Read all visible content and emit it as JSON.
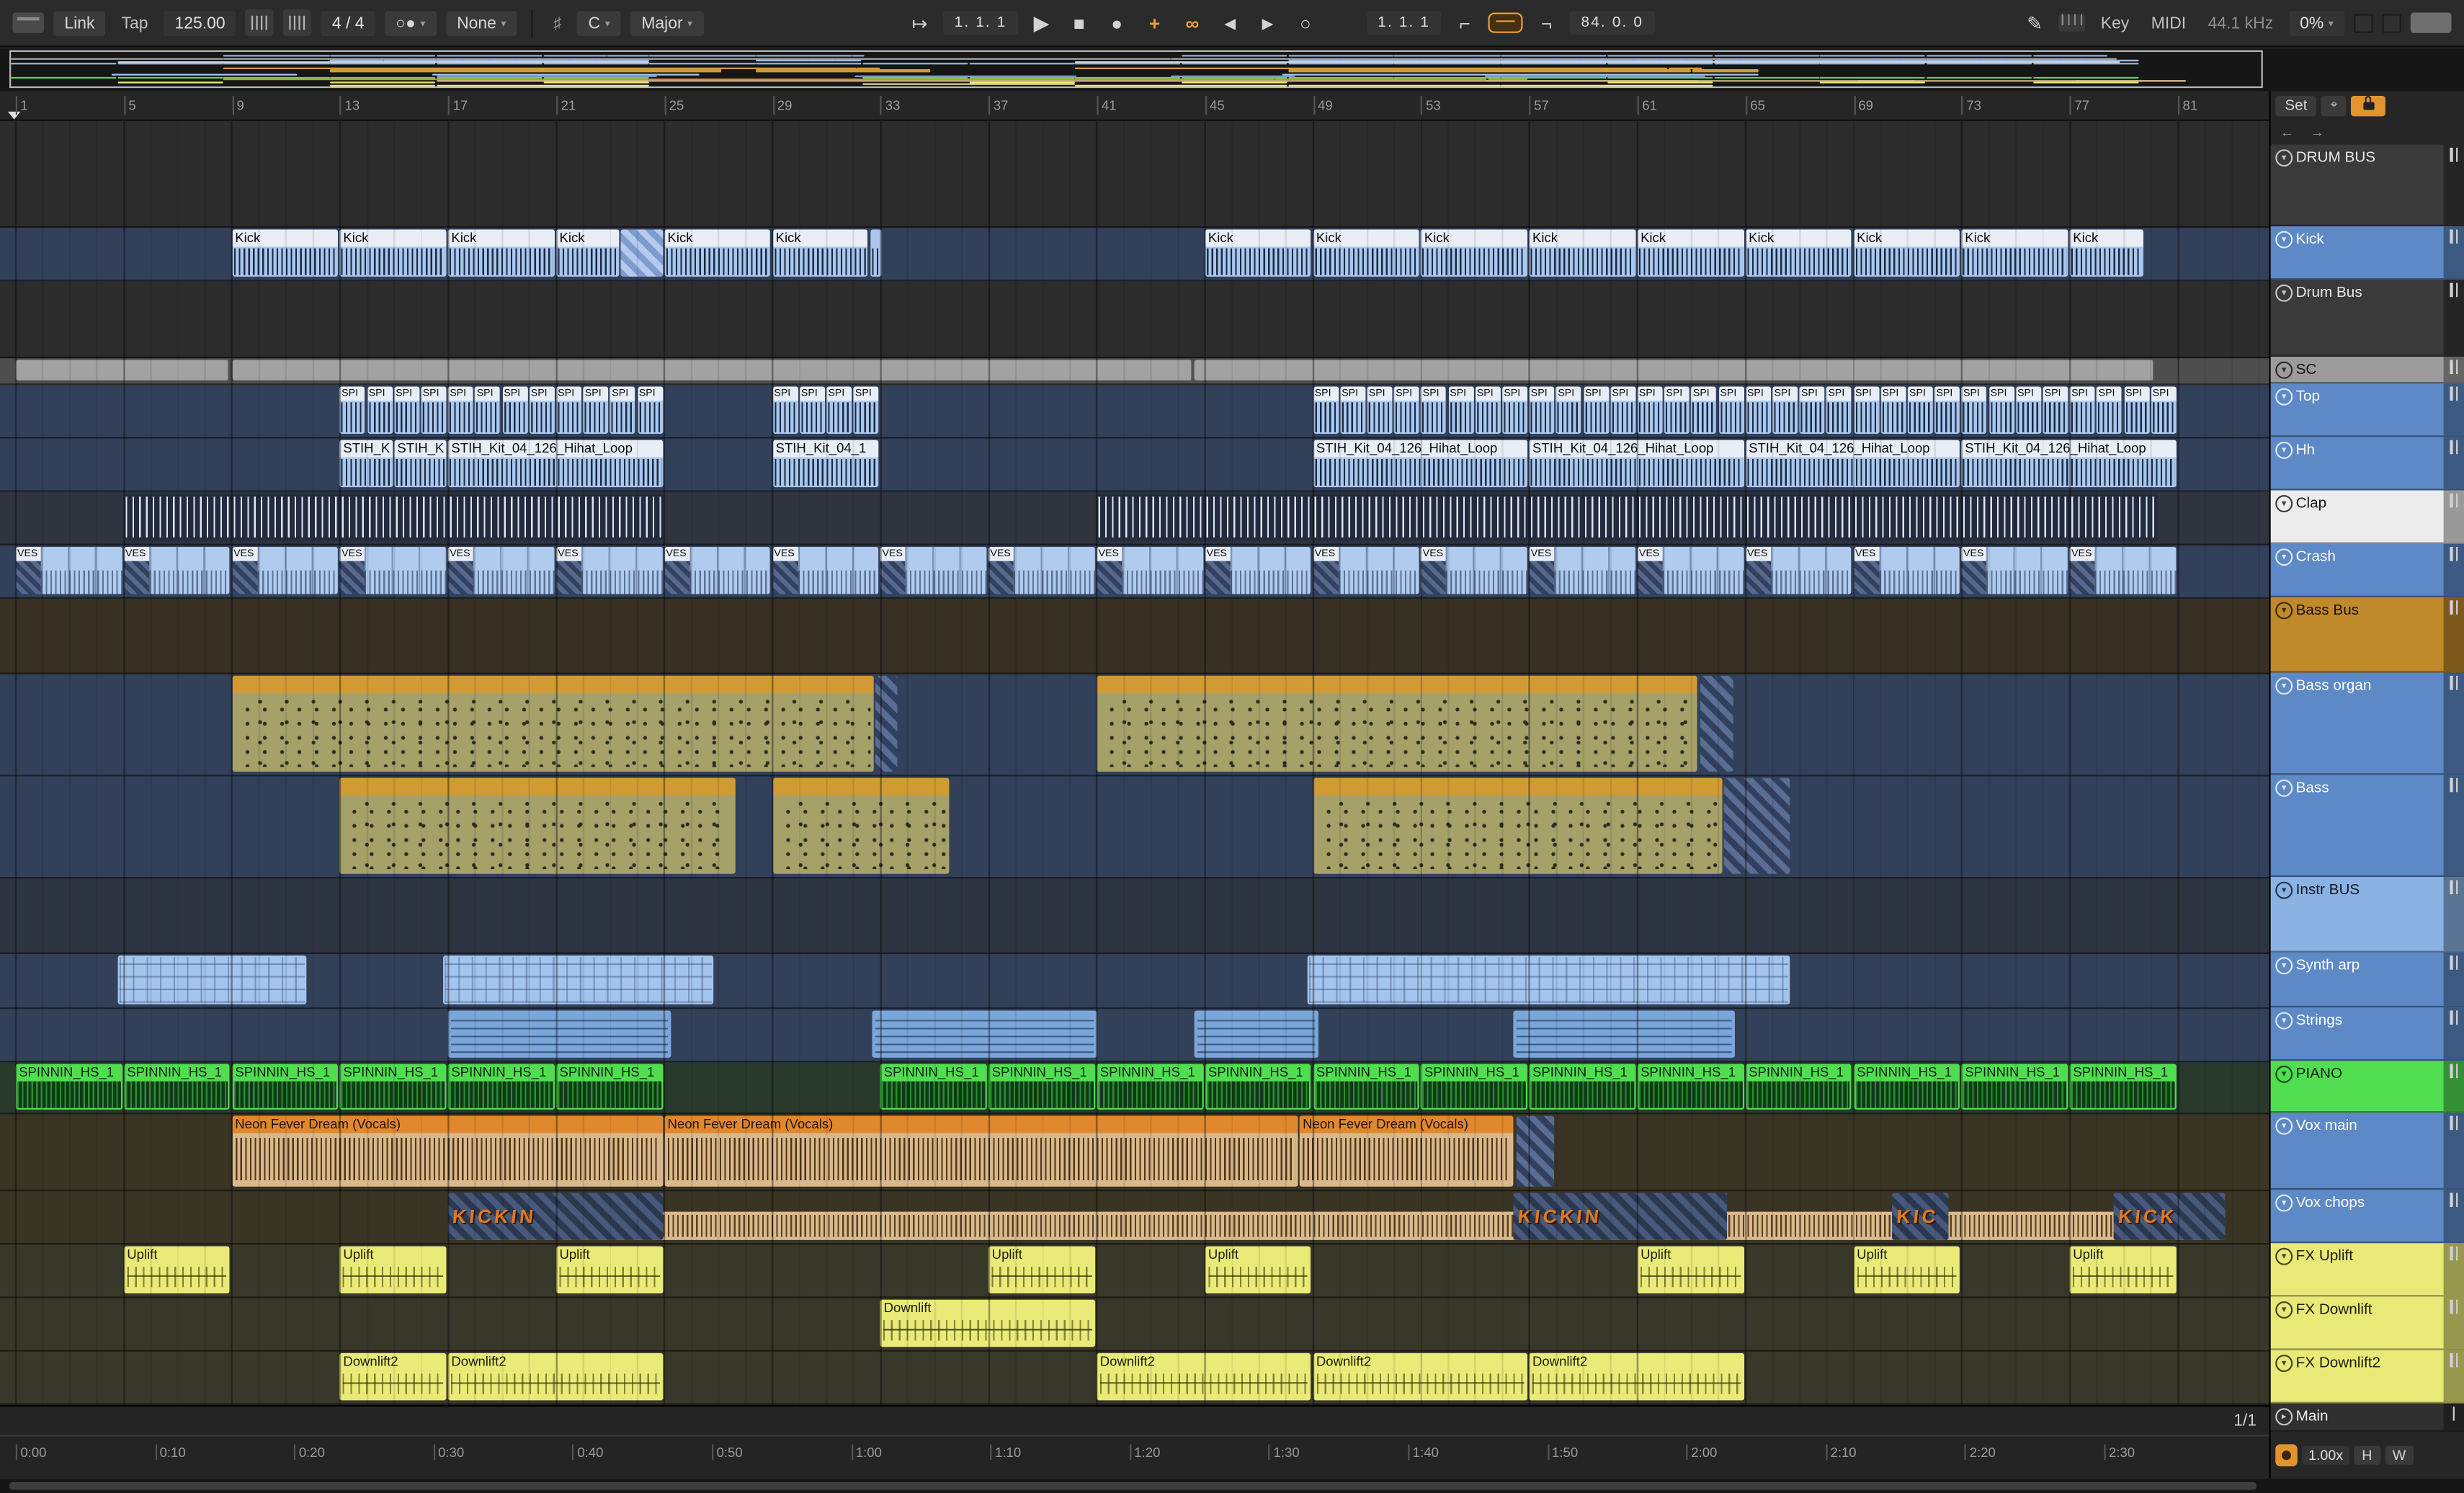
{
  "toolbar": {
    "link": "Link",
    "tap": "Tap",
    "tempo": "125.00",
    "time_sig": "4 / 4",
    "groove": "None",
    "scale_root": "C",
    "scale_name": "Major",
    "position": "1.  1.  1",
    "loop_start": "1.  1.  1",
    "loop_length": "84. 0. 0",
    "key": "Key",
    "midi": "MIDI",
    "sample_rate": "44.1 kHz",
    "cpu": "0%"
  },
  "sidebar": {
    "set": "Set",
    "back": "←",
    "forward": "→",
    "main": "Main",
    "pane": "1/1",
    "zoom": "1.00x",
    "h": "H",
    "w": "W"
  },
  "ruler_bars": [
    1,
    5,
    9,
    13,
    17,
    21,
    25,
    29,
    33,
    37,
    41,
    45,
    49,
    53,
    57,
    61,
    65,
    69,
    73,
    77,
    81
  ],
  "time_labels": [
    "0:00",
    "0:10",
    "0:20",
    "0:30",
    "0:40",
    "0:50",
    "1:00",
    "1:10",
    "1:20",
    "1:30",
    "1:40",
    "1:50",
    "2:00",
    "2:10",
    "2:20",
    "2:30"
  ],
  "accent_colors": {
    "active_orange": "#f0a030",
    "track_blue": "#5d89c6",
    "track_green": "#50de50",
    "track_yellow": "#e9e977",
    "track_orange": "#c08a2a"
  },
  "tracks": [
    {
      "name": "DRUM BUS",
      "group": true,
      "h": 68,
      "sh": 52,
      "cell": "#3a3a3a",
      "text": "#e8e8e8",
      "lane": "#2c2c2c",
      "ov": "#4a4a4a",
      "clips": []
    },
    {
      "name": "Kick",
      "h": 34,
      "cell": "#5d89c6",
      "text": "#ffffff",
      "lane": "#33405a",
      "kind": "kick",
      "ov": "#9db9e2",
      "clips": [
        {
          "s": 9,
          "l": 4,
          "lab": "Kick"
        },
        {
          "s": 13,
          "l": 4,
          "lab": "Kick"
        },
        {
          "s": 17,
          "l": 4,
          "lab": "Kick"
        },
        {
          "s": 21,
          "l": 2.4,
          "lab": "Kick"
        },
        {
          "s": 23.4,
          "l": 1.6,
          "kind": "kickhatch"
        },
        {
          "s": 25,
          "l": 4,
          "lab": "Kick"
        },
        {
          "s": 29,
          "l": 3.6,
          "lab": "Kick"
        },
        {
          "s": 32.6,
          "l": 0.5
        },
        {
          "s": 45,
          "l": 4,
          "lab": "Kick"
        },
        {
          "s": 49,
          "l": 4,
          "lab": "Kick"
        },
        {
          "s": 53,
          "l": 4,
          "lab": "Kick"
        },
        {
          "s": 57,
          "l": 4,
          "lab": "Kick"
        },
        {
          "s": 61,
          "l": 4,
          "lab": "Kick"
        },
        {
          "s": 65,
          "l": 4,
          "lab": "Kick"
        },
        {
          "s": 69,
          "l": 4,
          "lab": "Kick"
        },
        {
          "s": 73,
          "l": 4,
          "lab": "Kick"
        },
        {
          "s": 77,
          "l": 2.8,
          "lab": "Kick"
        }
      ]
    },
    {
      "name": "Drum Bus",
      "group": true,
      "h": 49,
      "cell": "#3a3a3a",
      "text": "#e8e8e8",
      "lane": "#2c2c2c",
      "ov": "#4a4a4a",
      "clips": []
    },
    {
      "name": "SC",
      "h": 17,
      "cell": "#9c9c9c",
      "text": "#111111",
      "lane": "#4e4e4e",
      "kind": "gray",
      "ov": "#a8a8a8",
      "clips": [
        {
          "s": 1,
          "l": 8
        },
        {
          "s": 9,
          "l": 35.6
        },
        {
          "s": 44.6,
          "l": 35.6
        }
      ]
    },
    {
      "name": "Top",
      "h": 34,
      "cell": "#5d89c6",
      "text": "#ffffff",
      "lane": "#33405a",
      "kind": "spi",
      "ov": "#9db9e2",
      "clips": [
        {
          "rep": {
            "from": 13,
            "count": 12,
            "step": 1
          },
          "l": 1,
          "lab": "SPI"
        },
        {
          "rep": {
            "from": 29,
            "count": 4,
            "step": 1
          },
          "l": 1,
          "lab": "SPI"
        },
        {
          "rep": {
            "from": 49,
            "count": 32,
            "step": 1
          },
          "l": 1,
          "lab": "SPI"
        }
      ]
    },
    {
      "name": "Hh",
      "h": 34,
      "cell": "#5d89c6",
      "text": "#ffffff",
      "lane": "#33405a",
      "kind": "stih",
      "ov": "#9db9e2",
      "clips": [
        {
          "s": 13,
          "l": 2,
          "lab": "STIH_K"
        },
        {
          "s": 15,
          "l": 2,
          "lab": "STIH_K"
        },
        {
          "s": 17,
          "l": 8,
          "lab": "STIH_Kit_04_126_Hihat_Loop"
        },
        {
          "s": 29,
          "l": 4,
          "lab": "STIH_Kit_04_1"
        },
        {
          "s": 49,
          "l": 8,
          "lab": "STIH_Kit_04_126_Hihat_Loop"
        },
        {
          "s": 57,
          "l": 8,
          "lab": "STIH_Kit_04_126_Hihat_Loop"
        },
        {
          "s": 65,
          "l": 8,
          "lab": "STIH_Kit_04_126_Hihat_Loop"
        },
        {
          "s": 73,
          "l": 8,
          "lab": "STIH_Kit_04_126_Hihat_Loop"
        }
      ]
    },
    {
      "name": "Clap",
      "h": 34,
      "cell": "#ececec",
      "text": "#111111",
      "lane": "#30343e",
      "kind": "tick",
      "ov": "#d8dde8",
      "clips": [
        {
          "s": 5,
          "l": 20
        },
        {
          "s": 41,
          "l": 39.3
        }
      ]
    },
    {
      "name": "Crash",
      "h": 34,
      "cell": "#5d89c6",
      "text": "#ffffff",
      "lane": "#33405a",
      "kind": "ves",
      "ov": "#9db9e2",
      "clips": [
        {
          "rep": {
            "from": 1,
            "count": 20,
            "step": 4
          },
          "l": 4,
          "lab": "VES"
        }
      ]
    },
    {
      "name": "Bass Bus",
      "group": true,
      "h": 48,
      "cell": "#c08a2a",
      "text": "#1a1206",
      "lane": "#383023",
      "ov": "#c08a2a",
      "clips": []
    },
    {
      "name": "Bass organ",
      "h": 65,
      "cell": "#5d89c6",
      "text": "#ffffff",
      "lane": "#33405a",
      "kind": "midi",
      "ov": "#d29a33",
      "clips": [
        {
          "s": 9,
          "l": 23.8
        },
        {
          "s": 32.8,
          "l": 0.9,
          "kind": "mhatch"
        },
        {
          "s": 41,
          "l": 22.3
        },
        {
          "s": 63.3,
          "l": 1.3,
          "kind": "mhatch"
        }
      ]
    },
    {
      "name": "Bass",
      "h": 65,
      "cell": "#5d89c6",
      "text": "#ffffff",
      "lane": "#33405a",
      "kind": "midi",
      "ov": "#d29a33",
      "clips": [
        {
          "s": 13,
          "l": 14.7
        },
        {
          "s": 29,
          "l": 6.6
        },
        {
          "s": 49,
          "l": 15.2
        },
        {
          "s": 64.2,
          "l": 2.5,
          "kind": "mhatch"
        }
      ]
    },
    {
      "name": "Instr BUS",
      "group": true,
      "h": 48,
      "cell": "#8ab2e2",
      "text": "#0c1930",
      "lane": "#2e3542",
      "ov": "#8ab2e2",
      "clips": []
    },
    {
      "name": "Synth arp",
      "h": 35,
      "cell": "#5d89c6",
      "text": "#ffffff",
      "lane": "#33405a",
      "kind": "arp",
      "ov": "#a3c4ec",
      "clips": [
        {
          "s": 4.8,
          "l": 7
        },
        {
          "s": 16.8,
          "l": 10.1
        },
        {
          "s": 48.8,
          "l": 17.9
        }
      ]
    },
    {
      "name": "Strings",
      "h": 34,
      "cell": "#5d89c6",
      "text": "#ffffff",
      "lane": "#33405a",
      "kind": "strings",
      "ov": "#7ba6da",
      "clips": [
        {
          "s": 17,
          "l": 8.3
        },
        {
          "s": 32.7,
          "l": 8.4
        },
        {
          "s": 44.6,
          "l": 4.7
        },
        {
          "s": 56.4,
          "l": 8.3
        }
      ]
    },
    {
      "name": "PIANO",
      "h": 33,
      "cell": "#50de50",
      "text": "#06230c",
      "lane": "#29392b",
      "kind": "piano",
      "ov": "#50de50",
      "clips": [
        {
          "rep": {
            "from": 1,
            "count": 6,
            "step": 4
          },
          "l": 4,
          "lab": "SPINNIN_HS_1"
        },
        {
          "rep": {
            "from": 33,
            "count": 12,
            "step": 4
          },
          "l": 4,
          "lab": "SPINNIN_HS_1"
        }
      ]
    },
    {
      "name": "Vox main",
      "h": 49,
      "cell": "#5d89c6",
      "text": "#ffffff",
      "lane": "#3a3424",
      "kind": "vox",
      "ov": "#e0882e",
      "clips": [
        {
          "s": 9,
          "l": 16,
          "lab": "Neon Fever Dream (Vocals)"
        },
        {
          "s": 25,
          "l": 23.5,
          "lab": "Neon Fever Dream (Vocals)"
        },
        {
          "s": 48.5,
          "l": 8,
          "lab": "Neon Fever Dream (Vocals)"
        },
        {
          "s": 56.5,
          "l": 1.5,
          "kind": "mhatch"
        }
      ]
    },
    {
      "name": "Vox chops",
      "h": 34,
      "cell": "#5d89c6",
      "text": "#ffffff",
      "lane": "#3a3424",
      "kind": "chops",
      "ov": "#d9ba8c",
      "clips": [
        {
          "s": 17,
          "l": 65.8,
          "low": true
        },
        {
          "s": 17,
          "l": 8,
          "kind": "stencil",
          "lab": "KICKIN"
        },
        {
          "s": 56.4,
          "l": 8,
          "kind": "stencil",
          "lab": "KICKIN"
        },
        {
          "s": 70.4,
          "l": 2.2,
          "kind": "stencil",
          "lab": "KIC"
        },
        {
          "s": 78.6,
          "l": 4.2,
          "kind": "stencil",
          "lab": "KICK"
        }
      ]
    },
    {
      "name": "FX Uplift",
      "h": 34,
      "cell": "#e9e977",
      "text": "#1d1d08",
      "lane": "#38382a",
      "kind": "fx",
      "ov": "#e9e977",
      "clips": [
        {
          "s": 5,
          "l": 4,
          "lab": "Uplift"
        },
        {
          "s": 13,
          "l": 4,
          "lab": "Uplift"
        },
        {
          "s": 21,
          "l": 4,
          "lab": "Uplift"
        },
        {
          "s": 37,
          "l": 4,
          "lab": "Uplift"
        },
        {
          "s": 45,
          "l": 4,
          "lab": "Uplift"
        },
        {
          "s": 61,
          "l": 4,
          "lab": "Uplift"
        },
        {
          "s": 69,
          "l": 4,
          "lab": "Uplift"
        },
        {
          "s": 77,
          "l": 4,
          "lab": "Uplift"
        }
      ]
    },
    {
      "name": "FX Downlift",
      "h": 34,
      "cell": "#e9e977",
      "text": "#1d1d08",
      "lane": "#38382a",
      "kind": "fx",
      "ov": "#e9e977",
      "clips": [
        {
          "s": 33,
          "l": 8,
          "lab": "Downlift"
        }
      ]
    },
    {
      "name": "FX Downlift2",
      "h": 34,
      "cell": "#e9e977",
      "text": "#1d1d08",
      "lane": "#38382a",
      "kind": "fx",
      "ov": "#e9e977",
      "clips": [
        {
          "s": 13,
          "l": 4,
          "lab": "Downlift2"
        },
        {
          "s": 17,
          "l": 8,
          "lab": "Downlift2"
        },
        {
          "s": 41,
          "l": 8,
          "lab": "Downlift2"
        },
        {
          "s": 49,
          "l": 8,
          "lab": "Downlift2"
        },
        {
          "s": 57,
          "l": 8,
          "lab": "Downlift2"
        }
      ]
    }
  ]
}
